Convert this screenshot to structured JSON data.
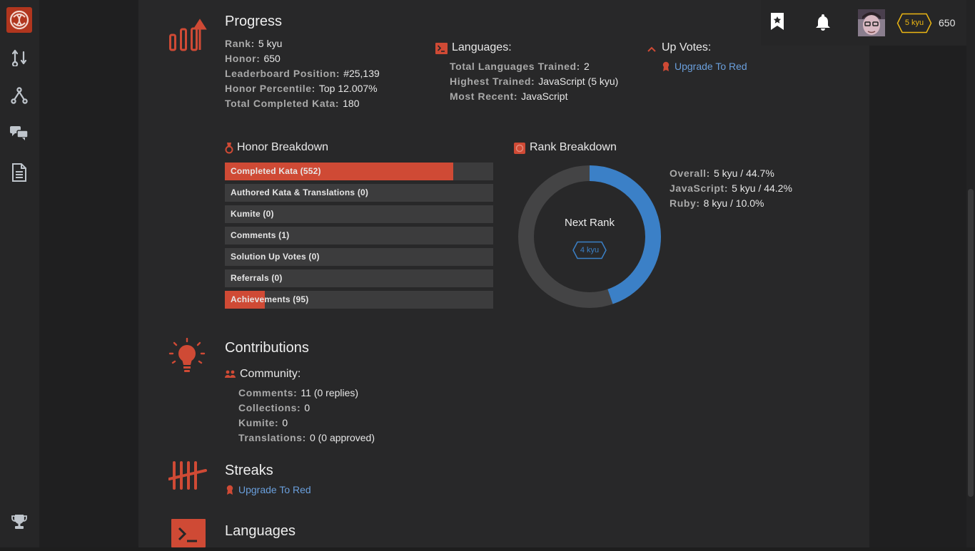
{
  "topbar": {
    "rank_badge": "5 kyu",
    "honor": "650"
  },
  "progress": {
    "title": "Progress",
    "stats": [
      {
        "label": "Rank:",
        "value": "5 kyu"
      },
      {
        "label": "Honor:",
        "value": "650"
      },
      {
        "label": "Leaderboard Position:",
        "value": "#25,139"
      },
      {
        "label": "Honor Percentile:",
        "value": "Top 12.007%"
      },
      {
        "label": "Total Completed Kata:",
        "value": "180"
      }
    ],
    "languages": {
      "title": "Languages:",
      "stats": [
        {
          "label": "Total Languages Trained:",
          "value": "2"
        },
        {
          "label": "Highest Trained:",
          "value": "JavaScript (5 kyu)"
        },
        {
          "label": "Most Recent:",
          "value": "JavaScript"
        }
      ]
    },
    "upvotes": {
      "title": "Up Votes:",
      "link": "Upgrade To Red"
    }
  },
  "honor_breakdown": {
    "title": "Honor Breakdown",
    "bars": [
      {
        "label": "Completed Kata (552)",
        "fill": 0.85
      },
      {
        "label": "Authored Kata & Translations (0)",
        "fill": 0
      },
      {
        "label": "Kumite (0)",
        "fill": 0
      },
      {
        "label": "Comments (1)",
        "fill": 0
      },
      {
        "label": "Solution Up Votes (0)",
        "fill": 0
      },
      {
        "label": "Referrals (0)",
        "fill": 0
      },
      {
        "label": "Achievements (95)",
        "fill": 0.15
      }
    ]
  },
  "rank_breakdown": {
    "title": "Rank Breakdown",
    "progress": 0.447,
    "center_label": "Next Rank",
    "next_rank": "4 kyu",
    "stats": [
      {
        "label": "Overall:",
        "value": "5 kyu / 44.7%"
      },
      {
        "label": "JavaScript:",
        "value": "5 kyu / 44.2%"
      },
      {
        "label": "Ruby:",
        "value": "8 kyu / 10.0%"
      }
    ]
  },
  "contributions": {
    "title": "Contributions",
    "community_title": "Community:",
    "stats": [
      {
        "label": "Comments:",
        "value": "11 (0 replies)"
      },
      {
        "label": "Collections:",
        "value": "0"
      },
      {
        "label": "Kumite:",
        "value": "0"
      },
      {
        "label": "Translations:",
        "value": "0 (0 approved)"
      }
    ]
  },
  "streaks": {
    "title": "Streaks",
    "link": "Upgrade To Red"
  },
  "languages_section": {
    "title": "Languages"
  },
  "colors": {
    "accent": "#cf4a35",
    "blue": "#3b80c7",
    "link": "#6a9fdc",
    "gold": "#ecb613"
  }
}
